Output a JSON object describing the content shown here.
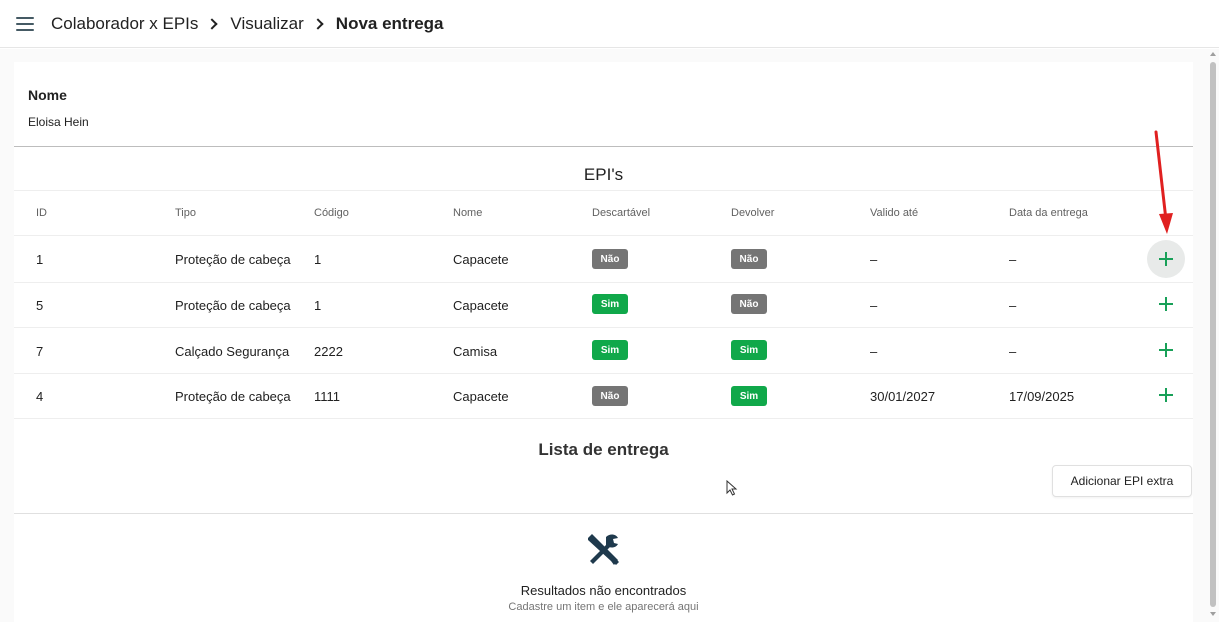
{
  "breadcrumb": {
    "items": [
      "Colaborador x EPIs",
      "Visualizar"
    ],
    "current": "Nova entrega"
  },
  "collaborator": {
    "label": "Nome",
    "value": "Eloisa Hein"
  },
  "epis": {
    "title": "EPI's",
    "columns": [
      "ID",
      "Tipo",
      "Código",
      "Nome",
      "Descartável",
      "Devolver",
      "Valido até",
      "Data da entrega"
    ],
    "rows": [
      {
        "id": "1",
        "tipo": "Proteção de cabeça",
        "codigo": "1",
        "nome": "Capacete",
        "descartavel": "Não",
        "devolver": "Não",
        "valido": "–",
        "entrega": "–"
      },
      {
        "id": "5",
        "tipo": "Proteção de cabeça",
        "codigo": "1",
        "nome": "Capacete",
        "descartavel": "Sim",
        "devolver": "Não",
        "valido": "–",
        "entrega": "–"
      },
      {
        "id": "7",
        "tipo": "Calçado Segurança",
        "codigo": "2222",
        "nome": "Camisa",
        "descartavel": "Sim",
        "devolver": "Sim",
        "valido": "–",
        "entrega": "–"
      },
      {
        "id": "4",
        "tipo": "Proteção de cabeça",
        "codigo": "1111",
        "nome": "Capacete",
        "descartavel": "Não",
        "devolver": "Sim",
        "valido": "30/01/2027",
        "entrega": "17/09/2025"
      }
    ]
  },
  "delivery_list": {
    "title": "Lista de entrega",
    "add_extra_label": "Adicionar EPI extra",
    "empty_title": "Resultados não encontrados",
    "empty_subtitle": "Cadastre um item e ele aparecerá aqui"
  },
  "icons": {
    "menu": "menu-icon",
    "add": "plus-icon",
    "empty": "tools-icon",
    "annotation": "red-arrow"
  },
  "colors": {
    "badge_yes": "#10a84a",
    "badge_no": "#757575",
    "plus": "#18a058",
    "empty_icon": "#1f3a4d",
    "annotation_arrow": "#e02020"
  }
}
